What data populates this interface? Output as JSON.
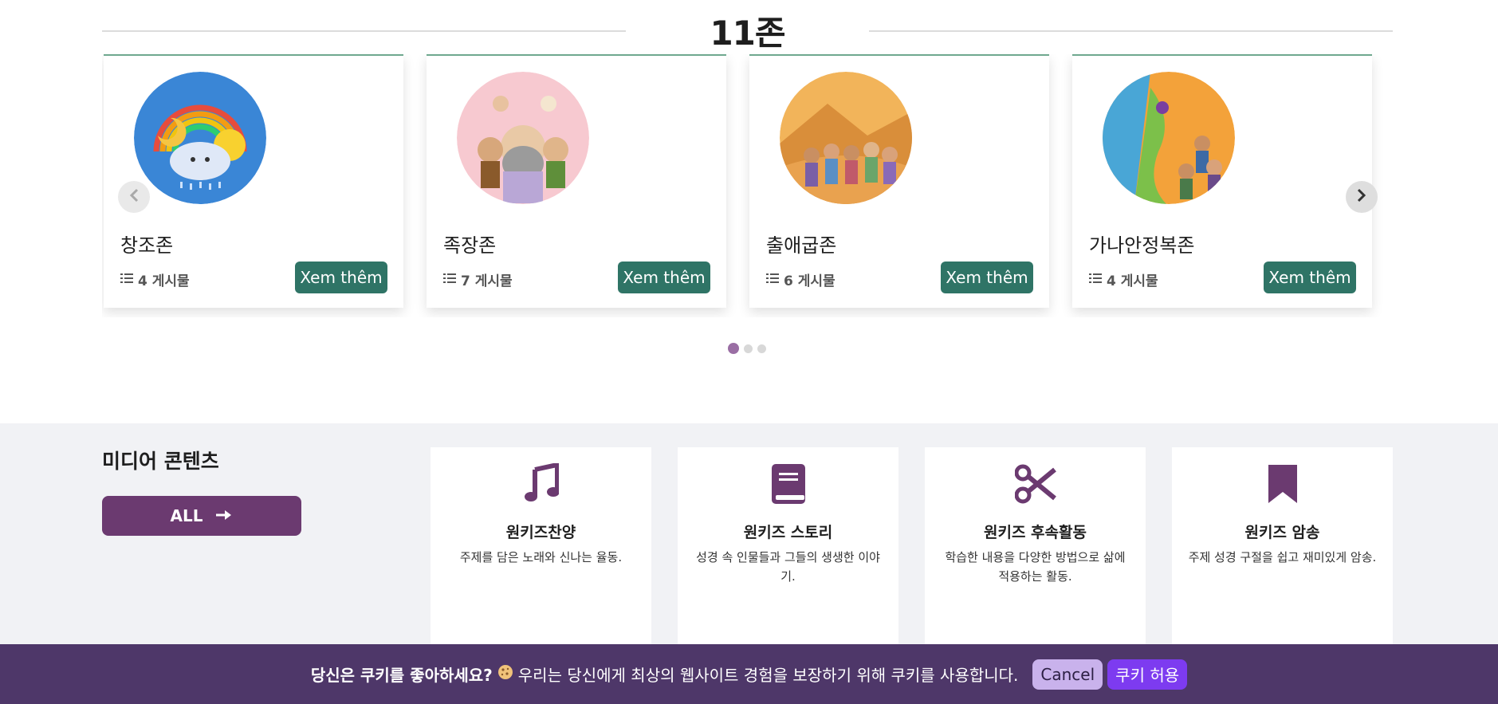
{
  "zones": {
    "title": "11존",
    "cards": [
      {
        "name": "창조존",
        "count": "4 게시물",
        "button": "Xem thêm"
      },
      {
        "name": "족장존",
        "count": "7 게시물",
        "button": "Xem thêm"
      },
      {
        "name": "출애굽존",
        "count": "6 게시물",
        "button": "Xem thêm"
      },
      {
        "name": "가나안정복존",
        "count": "4 게시물",
        "button": "Xem thêm"
      }
    ],
    "pagination": {
      "current": 1,
      "total": 3
    }
  },
  "media": {
    "heading": "미디어 콘텐츠",
    "all_label": "ALL",
    "cards": [
      {
        "icon": "music-note-icon",
        "title": "원키즈찬양",
        "desc": "주제를 담은 노래와 신나는 율동."
      },
      {
        "icon": "book-icon",
        "title": "원키즈 스토리",
        "desc": "성경 속 인물들과 그들의 생생한 이야기."
      },
      {
        "icon": "scissors-icon",
        "title": "원키즈 후속활동",
        "desc": "학습한 내용을 다양한 방법으로 삶에 적용하는 활동."
      },
      {
        "icon": "bookmark-icon",
        "title": "원키즈 암송",
        "desc": "주제 성경 구절을 쉽고 재미있게 암송."
      }
    ]
  },
  "cookie": {
    "question": "당신은 쿠키를 좋아하세요?",
    "message": "우리는 당신에게 최상의 웹사이트 경험을 보장하기 위해 쿠키를 사용합니다.",
    "cancel_label": "Cancel",
    "accept_label": "쿠키 허용"
  },
  "colors": {
    "accent_green": "#2f7466",
    "accent_purple": "#6b3a70",
    "cookie_bar": "#4e3769",
    "accept_button": "#7d3bf0"
  }
}
